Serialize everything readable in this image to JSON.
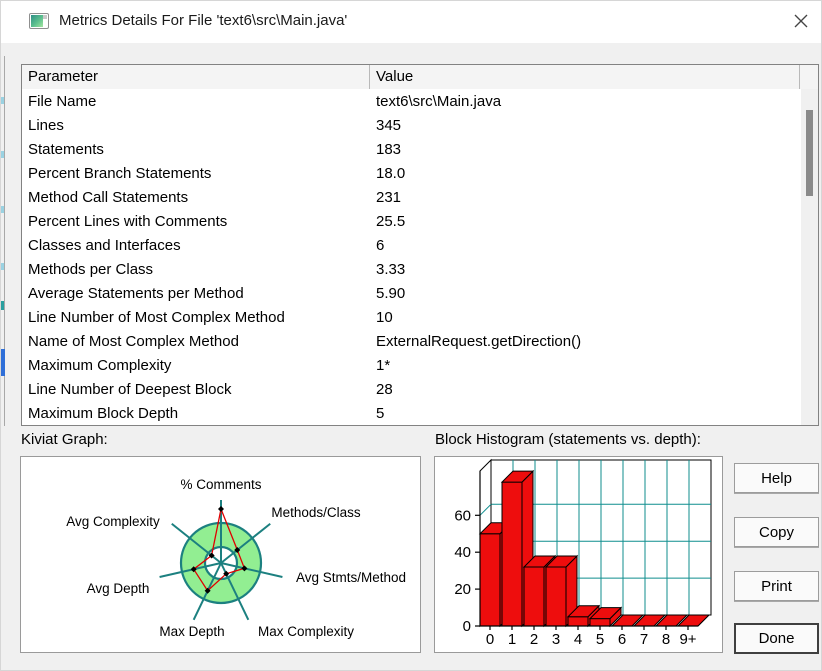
{
  "window": {
    "title": "Metrics Details For File 'text6\\src\\Main.java'",
    "icons": {
      "app": "metrics-window-icon",
      "close": "✕"
    }
  },
  "table": {
    "columns": [
      "Parameter",
      "Value"
    ],
    "rows": [
      [
        "File Name",
        "text6\\src\\Main.java"
      ],
      [
        "Lines",
        "345"
      ],
      [
        "Statements",
        "183"
      ],
      [
        "Percent Branch Statements",
        "18.0"
      ],
      [
        "Method Call Statements",
        "231"
      ],
      [
        "Percent Lines with Comments",
        "25.5"
      ],
      [
        "Classes and Interfaces",
        "6"
      ],
      [
        "Methods per Class",
        "3.33"
      ],
      [
        "Average Statements per Method",
        "5.90"
      ],
      [
        "Line Number of Most Complex Method",
        "10"
      ],
      [
        "Name of Most Complex Method",
        "ExternalRequest.getDirection()"
      ],
      [
        "Maximum Complexity",
        "1*"
      ],
      [
        "Line Number of Deepest Block",
        "28"
      ],
      [
        "Maximum Block Depth",
        "5"
      ]
    ]
  },
  "sections": {
    "kiviat_label": "Kiviat Graph:",
    "histogram_label": "Block Histogram (statements vs. depth):"
  },
  "buttons": [
    "Help",
    "Copy",
    "Print",
    "Done"
  ],
  "chart_data": [
    {
      "type": "radar",
      "title": "Kiviat Graph",
      "axes": [
        "% Comments",
        "Methods/Class",
        "Avg Stmts/Method",
        "Max Complexity",
        "Max Depth",
        "Avg Depth",
        "Avg Complexity"
      ],
      "values_pct_of_outer_ring": [
        135,
        52,
        60,
        30,
        77,
        70,
        30
      ],
      "ring": {
        "inner_pct": 40,
        "outer_pct": 100,
        "fill": "#92ee92",
        "stroke": "#1c8080"
      },
      "line_color": "#e00000",
      "marker_color": "#000000"
    },
    {
      "type": "bar",
      "title": "Block Histogram (statements vs. depth)",
      "categories": [
        "0",
        "1",
        "2",
        "3",
        "4",
        "5",
        "6",
        "7",
        "8",
        "9+"
      ],
      "values": [
        50,
        78,
        32,
        32,
        5,
        4,
        0,
        0,
        0,
        0
      ],
      "xlabel": "depth",
      "ylabel": "statements",
      "ylim": [
        0,
        84
      ],
      "yticks": [
        0,
        20,
        40,
        60
      ],
      "grid": true,
      "style": "3d",
      "bar_color": "#ee0d0d",
      "grid_color": "#0f8e8e"
    }
  ]
}
